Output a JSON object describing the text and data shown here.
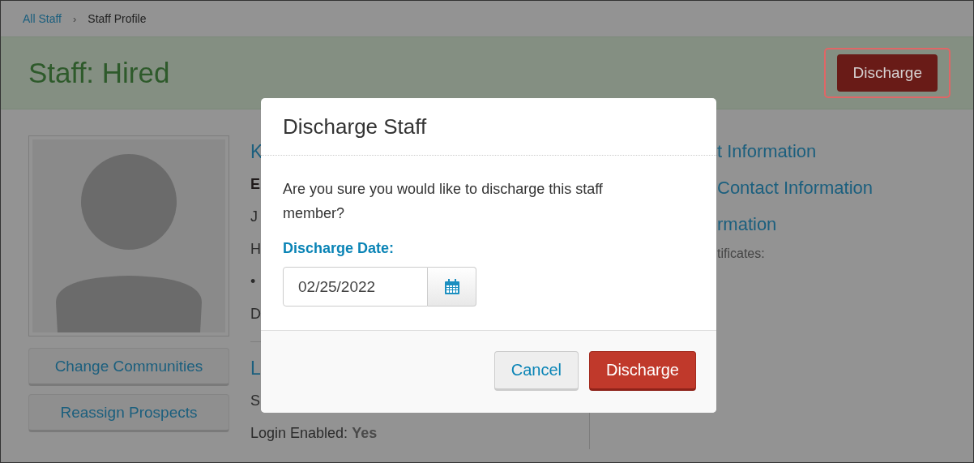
{
  "breadcrumb": [
    {
      "label": "All Staff",
      "kind": "link"
    },
    {
      "label": "Staff Profile",
      "kind": "current"
    }
  ],
  "breadcrumb_separator": "›",
  "header": {
    "title": "Staff: Hired",
    "action": "Discharge",
    "action_highlighted": true
  },
  "profile": {
    "buttons": [
      "Change Communities",
      "Reassign Prospects"
    ],
    "sections": [
      {
        "items": [
          {
            "kind": "heading",
            "text": "K"
          },
          {
            "kind": "bold",
            "text": "E"
          },
          {
            "kind": "text",
            "text": "J"
          },
          {
            "kind": "text",
            "text": "H"
          },
          {
            "kind": "text",
            "text": "•"
          },
          {
            "kind": "text",
            "text": "D"
          }
        ]
      },
      {
        "items": [
          {
            "kind": "heading",
            "text": "L"
          },
          {
            "kind": "text",
            "text": "S"
          },
          {
            "kind": "field",
            "label": "Login Enabled:",
            "value": "Yes"
          }
        ]
      }
    ]
  },
  "info": {
    "links": [
      "t Information",
      "Contact Information",
      "rmation"
    ],
    "label": "tificates:"
  },
  "modal": {
    "title": "Discharge Staff",
    "message": "Are you sure you would like to discharge this staff member?",
    "field_label": "Discharge Date:",
    "date": "02/25/2022",
    "buttons": [
      {
        "label": "Cancel",
        "kind": "default"
      },
      {
        "label": "Discharge",
        "kind": "danger"
      }
    ]
  }
}
